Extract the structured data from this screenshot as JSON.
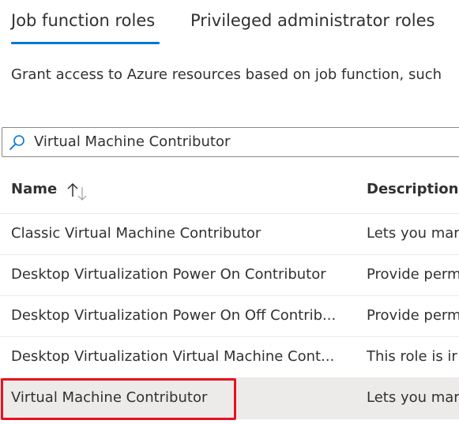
{
  "tabs": [
    {
      "label": "Job function roles",
      "active": true
    },
    {
      "label": "Privileged administrator roles",
      "active": false
    }
  ],
  "description": "Grant access to Azure resources based on job function, such",
  "search": {
    "value": "Virtual Machine Contributor",
    "icon": "search-icon"
  },
  "table": {
    "headers": {
      "name": "Name",
      "description": "Description"
    },
    "rows": [
      {
        "name": "Classic Virtual Machine Contributor",
        "description": "Lets you mar"
      },
      {
        "name": "Desktop Virtualization Power On Contributor",
        "description": "Provide perm"
      },
      {
        "name": "Desktop Virtualization Power On Off Contrib...",
        "description": "Provide perm"
      },
      {
        "name": "Desktop Virtualization Virtual Machine Cont...",
        "description": "This role is ir"
      },
      {
        "name": "Virtual Machine Contributor",
        "description": "Lets you mar"
      }
    ]
  },
  "colors": {
    "accent": "#0078d4",
    "highlight": "#e81123",
    "selected_row": "#edebe9"
  }
}
